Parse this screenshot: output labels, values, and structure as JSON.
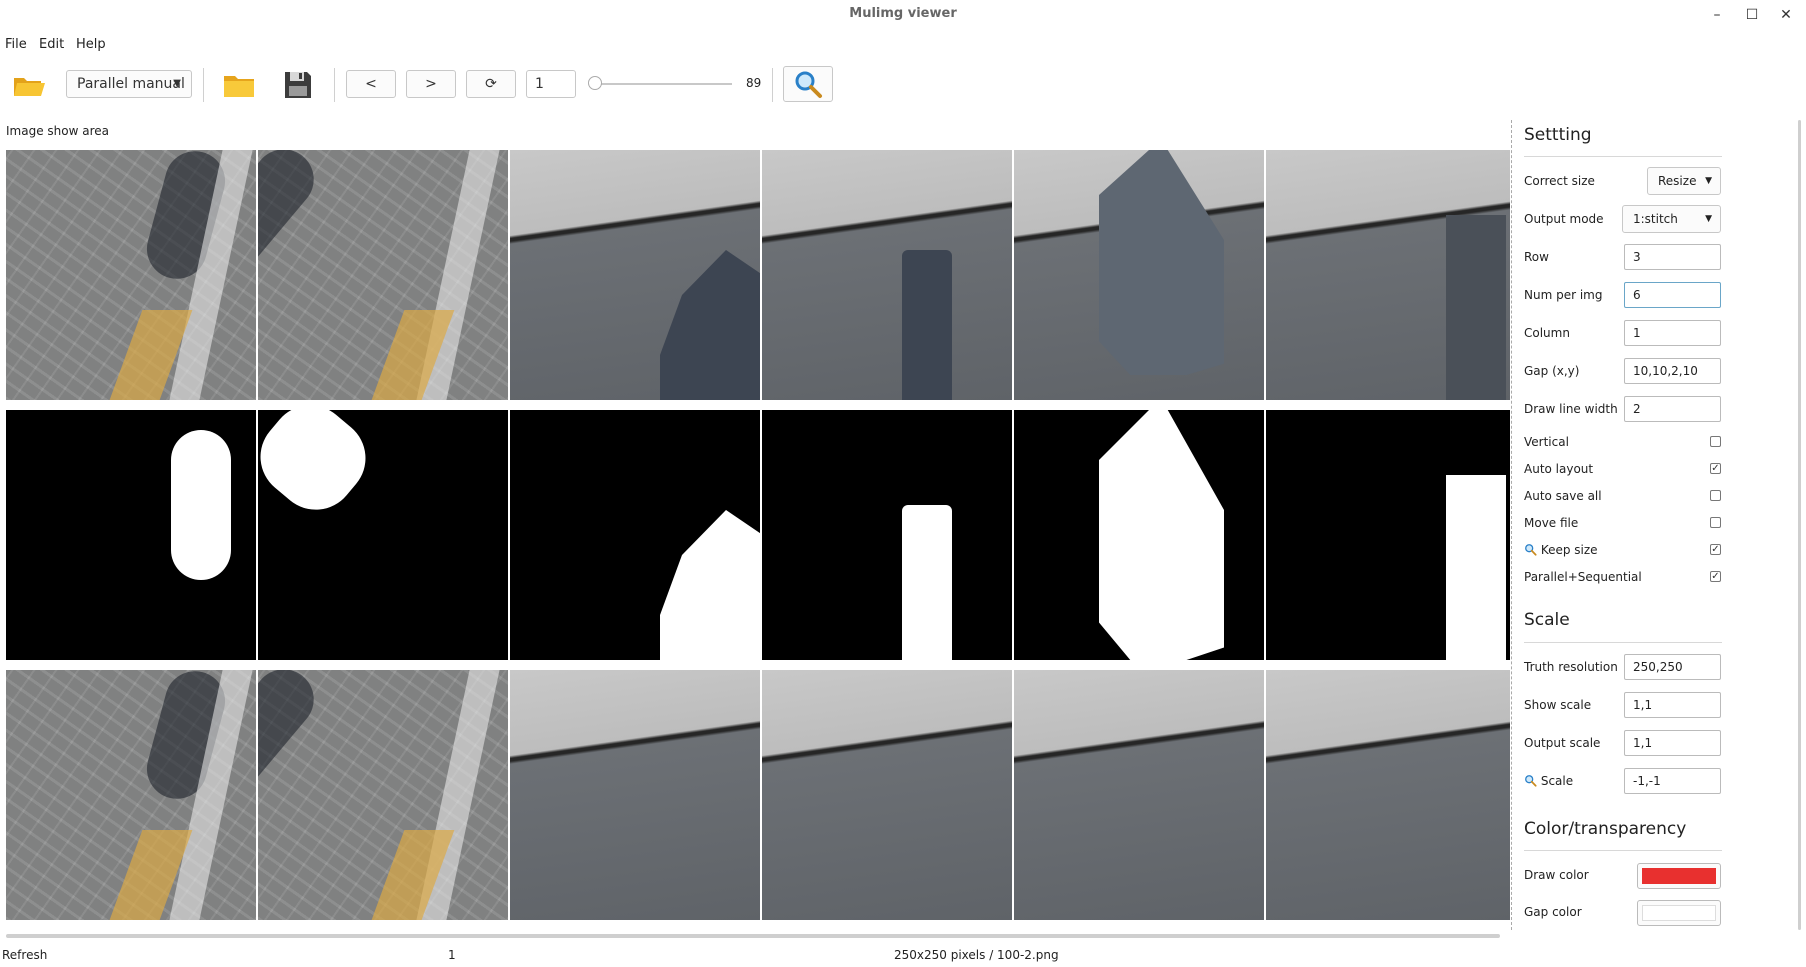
{
  "window": {
    "title": "Mulimg viewer",
    "minimize": "–",
    "maximize": "☐",
    "close": "✕"
  },
  "menu": {
    "file": "File",
    "edit": "Edit",
    "help": "Help"
  },
  "toolbar": {
    "mode_select": "Parallel manual",
    "prev": "<",
    "next": ">",
    "refresh": "⟳",
    "page": "1",
    "slider_value": "89",
    "slider_fraction": 0.0
  },
  "area_label": "Image show area",
  "grid": {
    "rows": [
      [
        "pave",
        "pave",
        "wall",
        "wall",
        "wall",
        "wall"
      ],
      [
        "mask",
        "mask",
        "mask",
        "mask",
        "mask",
        "mask"
      ],
      [
        "pave",
        "pave",
        "wall",
        "wall",
        "wall",
        "wall"
      ]
    ]
  },
  "panel": {
    "setting_title": "Settting",
    "correct_size_label": "Correct size",
    "correct_size_value": "Resize",
    "output_mode_label": "Output mode",
    "output_mode_value": "1:stitch",
    "row_label": "Row",
    "row_value": "3",
    "num_per_img_label": "Num per img",
    "num_per_img_value": "6",
    "column_label": "Column",
    "column_value": "1",
    "gap_label": "Gap (x,y)",
    "gap_value": "10,10,2,10",
    "draw_line_width_label": "Draw line width",
    "draw_line_width_value": "2",
    "vertical_label": "Vertical",
    "vertical_checked": "",
    "auto_layout_label": "Auto layout",
    "auto_layout_checked": "✓",
    "auto_save_all_label": "Auto save all",
    "auto_save_all_checked": "",
    "move_file_label": "Move file",
    "move_file_checked": "",
    "keep_size_label": "Keep size",
    "keep_size_checked": "✓",
    "parallel_seq_label": "Parallel+Sequential",
    "parallel_seq_checked": "✓",
    "scale_title": "Scale",
    "truth_resolution_label": "Truth resolution",
    "truth_resolution_value": "250,250",
    "show_scale_label": "Show scale",
    "show_scale_value": "1,1",
    "output_scale_label": "Output scale",
    "output_scale_value": "1,1",
    "scale_label": "Scale",
    "scale_value": "-1,-1",
    "color_title": "Color/transparency",
    "draw_color_label": "Draw  color",
    "draw_color": "#e8302f",
    "gap_color_label": "Gap color",
    "gap_color": "#ffffff"
  },
  "status": {
    "left": "Refresh",
    "mid": "1",
    "right": "250x250 pixels / 100-2.png"
  }
}
